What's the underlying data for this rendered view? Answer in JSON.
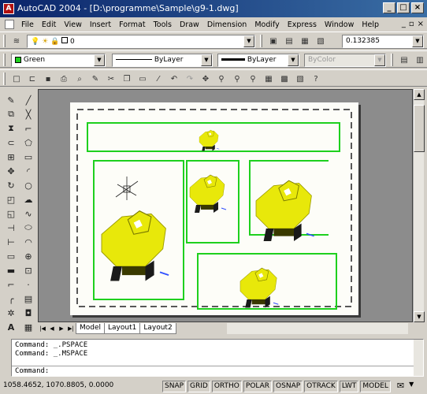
{
  "window": {
    "title": "AutoCAD 2004 - [D:\\programme\\Sample\\g9-1.dwg]"
  },
  "menu": [
    "File",
    "Edit",
    "View",
    "Insert",
    "Format",
    "Tools",
    "Draw",
    "Dimension",
    "Modify",
    "Express",
    "Window",
    "Help"
  ],
  "layers": {
    "current_layer": "0",
    "scale_value": "0.132385"
  },
  "properties": {
    "color": "Green",
    "linetype": "ByLayer",
    "lineweight": "ByLayer",
    "plotstyle": "ByColor"
  },
  "layout_tabs": [
    "Model",
    "Layout1",
    "Layout2"
  ],
  "active_tab": "Layout1",
  "command_history": [
    "Command: _.PSPACE",
    "Command: _.MSPACE"
  ],
  "command_prompt": "Command:",
  "status": {
    "coordinates": "1058.4652, 1070.8805, 0.0000",
    "toggles": [
      "SNAP",
      "GRID",
      "ORTHO",
      "POLAR",
      "OSNAP",
      "OTRACK",
      "LWT",
      "MODEL"
    ]
  },
  "colors": {
    "viewport_border": "#1ed01e",
    "model_fill": "#e8e80a",
    "title_bar": "#0a246a",
    "canvas_bg": "#8c8c8c"
  }
}
